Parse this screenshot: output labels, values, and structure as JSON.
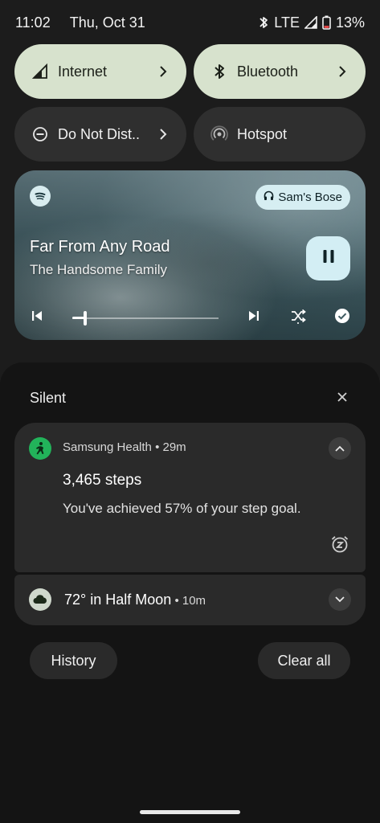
{
  "status_bar": {
    "time": "11:02",
    "date": "Thu, Oct 31",
    "network": "LTE",
    "battery": "13%",
    "icons": [
      "bluetooth-icon",
      "signal-icon",
      "battery-icon"
    ]
  },
  "quick_settings": {
    "tiles": [
      {
        "label": "Internet",
        "icon": "signal-icon",
        "active": true,
        "has_chevron": true
      },
      {
        "label": "Bluetooth",
        "icon": "bluetooth-icon",
        "active": true,
        "has_chevron": true
      },
      {
        "label": "Do Not Dist..",
        "icon": "dnd-icon",
        "active": false,
        "has_chevron": true
      },
      {
        "label": "Hotspot",
        "icon": "hotspot-icon",
        "active": false,
        "has_chevron": false
      }
    ]
  },
  "media": {
    "app_icon": "spotify-icon",
    "output_device": "Sam's Bose",
    "title": "Far From Any Road",
    "artist": "The Handsome Family",
    "progress": 0.09,
    "controls": [
      "previous-icon",
      "pause-icon",
      "next-icon",
      "shuffle-icon",
      "liked-icon"
    ]
  },
  "shade": {
    "section_title": "Silent",
    "notifications": [
      {
        "app": "Samsung Health",
        "time": "29m",
        "title": "3,465 steps",
        "text": "You've achieved 57% of your step goal.",
        "expanded": true
      },
      {
        "title": "72° in Half Moon",
        "time": "10m",
        "expanded": false
      }
    ],
    "history_label": "History",
    "clear_all_label": "Clear all"
  },
  "colors": {
    "tile_active": "#d7e2cd",
    "tile_inactive": "#2f2f2f",
    "background": "#1c1c1c",
    "shade": "#141414",
    "card": "#2a2a2a",
    "health_green": "#22b35a",
    "media_accent": "#d3eef4"
  }
}
